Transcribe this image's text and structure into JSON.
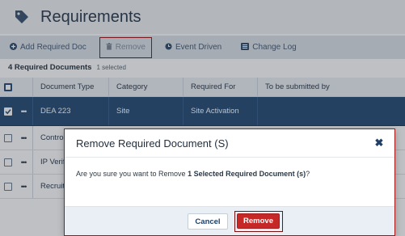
{
  "page": {
    "title": "Requirements",
    "icon": "tag-icon"
  },
  "toolbar": {
    "add_label": "Add Required Doc",
    "remove_label": "Remove",
    "event_label": "Event Driven",
    "log_label": "Change Log"
  },
  "summary": {
    "count_label": "4 Required Documents",
    "selected_label": "1 selected"
  },
  "grid": {
    "columns": [
      "Document Type",
      "Category",
      "Required For",
      "To be submitted by"
    ],
    "rows": [
      {
        "type": "DEA 223",
        "category": "Site",
        "required_for": "Site Activation",
        "submitted_by": "",
        "selected": true
      },
      {
        "type": "Contro",
        "category": "",
        "required_for": "",
        "submitted_by": "",
        "selected": false
      },
      {
        "type": "IP Verifi",
        "category": "",
        "required_for": "",
        "submitted_by": "",
        "selected": false
      },
      {
        "type": "Recruit",
        "category": "",
        "required_for": "",
        "submitted_by": "",
        "selected": false
      }
    ]
  },
  "modal": {
    "title": "Remove Required Document (S)",
    "message_prefix": "Are you sure you want to Remove ",
    "message_bold": "1 Selected Required Document (s)",
    "message_suffix": "?",
    "cancel_label": "Cancel",
    "remove_label": "Remove",
    "close_glyph": "✖"
  },
  "colors": {
    "accent": "#2c4f78",
    "danger": "#c62828",
    "highlight_border": "#a31515"
  }
}
